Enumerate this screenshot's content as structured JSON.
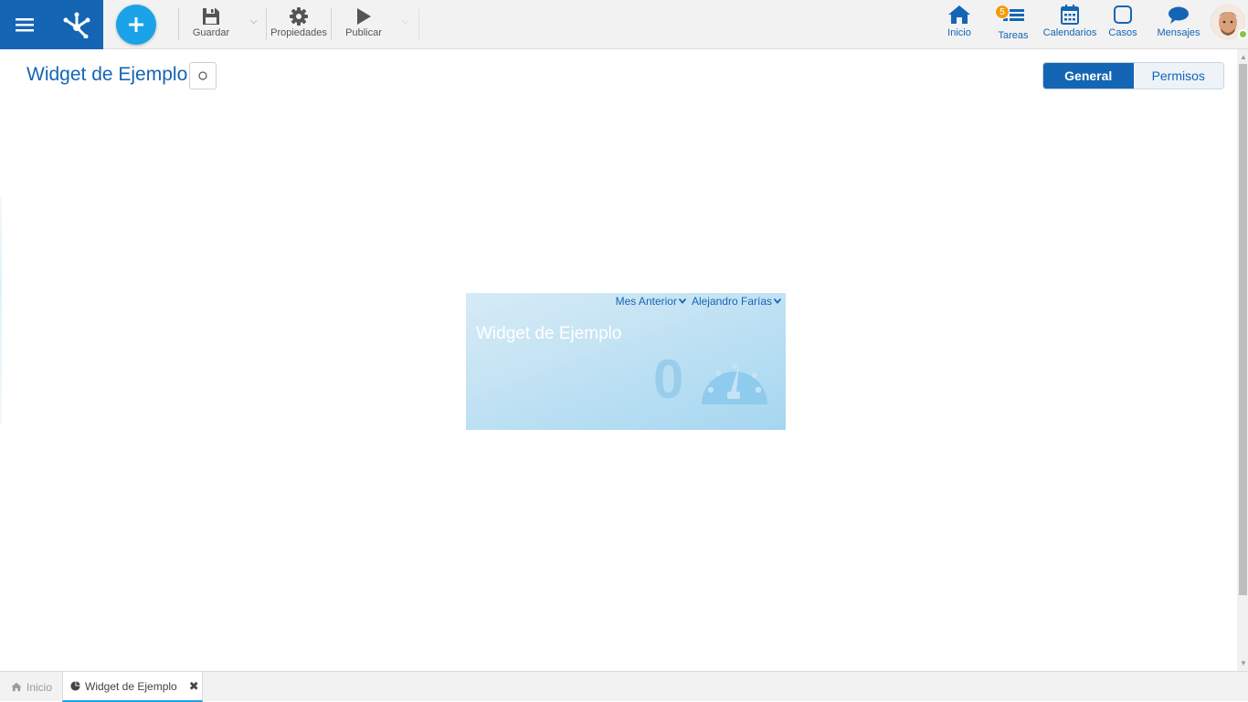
{
  "toolbar": {
    "save_label": "Guardar",
    "properties_label": "Propiedades",
    "publish_label": "Publicar"
  },
  "nav": {
    "inicio": "Inicio",
    "tareas": "Tareas",
    "tareas_badge": "5",
    "calendarios": "Calendarios",
    "casos": "Casos",
    "mensajes": "Mensajes"
  },
  "page": {
    "title": "Widget de Ejemplo",
    "tabs": [
      {
        "label": "General",
        "active": true
      },
      {
        "label": "Permisos",
        "active": false
      }
    ]
  },
  "widget": {
    "filter_period": "Mes Anterior",
    "filter_user": "Alejandro Farías",
    "title": "Widget de Ejemplo",
    "value": "0",
    "icon": "gauge-icon"
  },
  "bottom_tabs": {
    "home": "Inicio",
    "current": "Widget de Ejemplo"
  },
  "colors": {
    "brand_blue": "#1565b5",
    "accent_cyan": "#1aa3e8",
    "badge_orange": "#f39c12"
  }
}
